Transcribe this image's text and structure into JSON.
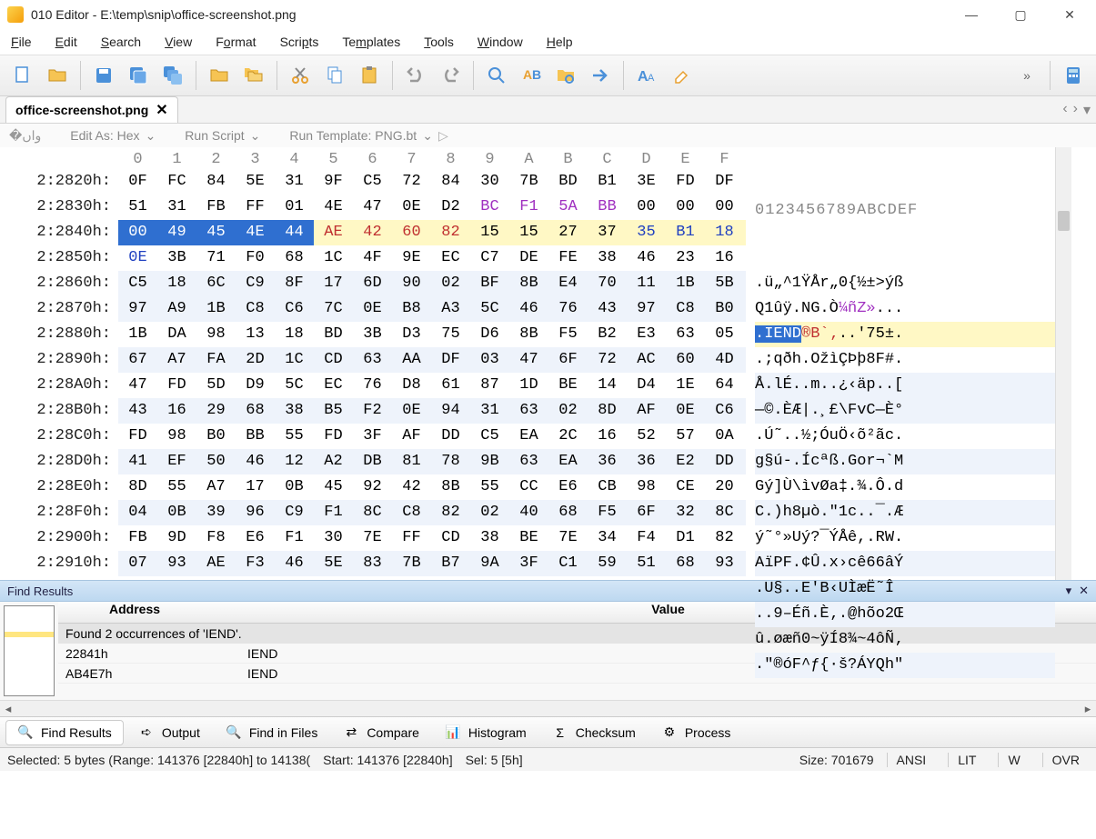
{
  "window": {
    "title": "010 Editor - E:\\temp\\snip\\office-screenshot.png"
  },
  "menu": [
    "File",
    "Edit",
    "Search",
    "View",
    "Format",
    "Scripts",
    "Templates",
    "Tools",
    "Window",
    "Help"
  ],
  "tab": {
    "label": "office-screenshot.png"
  },
  "subbar": {
    "editas": "Edit As: Hex",
    "runscript": "Run Script",
    "runtemplate": "Run Template: PNG.bt"
  },
  "hex": {
    "col_hdr": [
      "0",
      "1",
      "2",
      "3",
      "4",
      "5",
      "6",
      "7",
      "8",
      "9",
      "A",
      "B",
      "C",
      "D",
      "E",
      "F"
    ],
    "asc_hdr": "0123456789ABCDEF",
    "rows": [
      {
        "addr": "2:2820h:",
        "bytes": [
          "0F",
          "FC",
          "84",
          "5E",
          "31",
          "9F",
          "C5",
          "72",
          "84",
          "30",
          "7B",
          "BD",
          "B1",
          "3E",
          "FD",
          "DF"
        ],
        "asc": ".ü„^1ŸÅr„0{½±>ýß",
        "alt": false
      },
      {
        "addr": "2:2830h:",
        "bytes": [
          "51",
          "31",
          "FB",
          "FF",
          "01",
          "4E",
          "47",
          "0E",
          "D2",
          "BC",
          "F1",
          "5A",
          "BB",
          "00",
          "00",
          "00"
        ],
        "asc": "Q1ûÿ.NG.Ò¼ñZ»...",
        "alt": false,
        "purple": [
          9,
          10,
          11,
          12
        ]
      },
      {
        "addr": "2:2840h:",
        "bytes": [
          "00",
          "49",
          "45",
          "4E",
          "44",
          "AE",
          "42",
          "60",
          "82",
          "15",
          "15",
          "27",
          "37",
          "35",
          "B1",
          "18"
        ],
        "asc": ".IEND®B`‚..'75±.",
        "sel": [
          0,
          1,
          2,
          3,
          4
        ],
        "red": [
          5,
          6,
          7,
          8
        ],
        "blue": [
          13,
          14,
          15
        ],
        "hl": true
      },
      {
        "addr": "2:2850h:",
        "bytes": [
          "0E",
          "3B",
          "71",
          "F0",
          "68",
          "1C",
          "4F",
          "9E",
          "EC",
          "C7",
          "DE",
          "FE",
          "38",
          "46",
          "23",
          "16"
        ],
        "asc": ".;qðh.OžìÇÞþ8F#.",
        "blue": [
          0
        ],
        "alt": false
      },
      {
        "addr": "2:2860h:",
        "bytes": [
          "C5",
          "18",
          "6C",
          "C9",
          "8F",
          "17",
          "6D",
          "90",
          "02",
          "BF",
          "8B",
          "E4",
          "70",
          "11",
          "1B",
          "5B"
        ],
        "asc": "Å.lÉ..m..¿‹äp..[",
        "alt": true
      },
      {
        "addr": "2:2870h:",
        "bytes": [
          "97",
          "A9",
          "1B",
          "C8",
          "C6",
          "7C",
          "0E",
          "B8",
          "A3",
          "5C",
          "46",
          "76",
          "43",
          "97",
          "C8",
          "B0"
        ],
        "asc": "—©.ÈÆ|.¸£\\FvC—È°",
        "alt": true
      },
      {
        "addr": "2:2880h:",
        "bytes": [
          "1B",
          "DA",
          "98",
          "13",
          "18",
          "BD",
          "3B",
          "D3",
          "75",
          "D6",
          "8B",
          "F5",
          "B2",
          "E3",
          "63",
          "05"
        ],
        "asc": ".Ú˜..½;ÓuÖ‹õ²ãc.",
        "alt": false
      },
      {
        "addr": "2:2890h:",
        "bytes": [
          "67",
          "A7",
          "FA",
          "2D",
          "1C",
          "CD",
          "63",
          "AA",
          "DF",
          "03",
          "47",
          "6F",
          "72",
          "AC",
          "60",
          "4D"
        ],
        "asc": "g§ú-.Ícªß.Gor¬`M",
        "alt": true
      },
      {
        "addr": "2:28A0h:",
        "bytes": [
          "47",
          "FD",
          "5D",
          "D9",
          "5C",
          "EC",
          "76",
          "D8",
          "61",
          "87",
          "1D",
          "BE",
          "14",
          "D4",
          "1E",
          "64"
        ],
        "asc": "Gý]Ù\\ìvØa‡.¾.Ô.d",
        "alt": false
      },
      {
        "addr": "2:28B0h:",
        "bytes": [
          "43",
          "16",
          "29",
          "68",
          "38",
          "B5",
          "F2",
          "0E",
          "94",
          "31",
          "63",
          "02",
          "8D",
          "AF",
          "0E",
          "C6"
        ],
        "asc": "C.)h8µò.\"1c..¯.Æ",
        "alt": true
      },
      {
        "addr": "2:28C0h:",
        "bytes": [
          "FD",
          "98",
          "B0",
          "BB",
          "55",
          "FD",
          "3F",
          "AF",
          "DD",
          "C5",
          "EA",
          "2C",
          "16",
          "52",
          "57",
          "0A"
        ],
        "asc": "ý˜°»Uý?¯ÝÅê,.RW.",
        "alt": false
      },
      {
        "addr": "2:28D0h:",
        "bytes": [
          "41",
          "EF",
          "50",
          "46",
          "12",
          "A2",
          "DB",
          "81",
          "78",
          "9B",
          "63",
          "EA",
          "36",
          "36",
          "E2",
          "DD"
        ],
        "asc": "AïPF.¢Û.x›cê66âÝ",
        "alt": true
      },
      {
        "addr": "2:28E0h:",
        "bytes": [
          "8D",
          "55",
          "A7",
          "17",
          "0B",
          "45",
          "92",
          "42",
          "8B",
          "55",
          "CC",
          "E6",
          "CB",
          "98",
          "CE",
          "20"
        ],
        "asc": ".U§..E'B‹UÌæË˜Î ",
        "alt": false
      },
      {
        "addr": "2:28F0h:",
        "bytes": [
          "04",
          "0B",
          "39",
          "96",
          "C9",
          "F1",
          "8C",
          "C8",
          "82",
          "02",
          "40",
          "68",
          "F5",
          "6F",
          "32",
          "8C"
        ],
        "asc": "..9–Éñ.È‚.@hõo2Œ",
        "alt": true
      },
      {
        "addr": "2:2900h:",
        "bytes": [
          "FB",
          "9D",
          "F8",
          "E6",
          "F1",
          "30",
          "7E",
          "FF",
          "CD",
          "38",
          "BE",
          "7E",
          "34",
          "F4",
          "D1",
          "82"
        ],
        "asc": "û.øæñ0~ÿÍ8¾~4ôÑ‚",
        "alt": false
      },
      {
        "addr": "2:2910h:",
        "bytes": [
          "07",
          "93",
          "AE",
          "F3",
          "46",
          "5E",
          "83",
          "7B",
          "B7",
          "9A",
          "3F",
          "C1",
          "59",
          "51",
          "68",
          "93"
        ],
        "asc": ".\"®óF^ƒ{·š?ÁYQh\"",
        "alt": true
      }
    ]
  },
  "find": {
    "title": "Find Results",
    "col_addr": "Address",
    "col_val": "Value",
    "msg": "Found 2 occurrences of 'IEND'.",
    "rows": [
      {
        "addr": "22841h",
        "val": "IEND"
      },
      {
        "addr": "AB4E7h",
        "val": "IEND"
      }
    ]
  },
  "bottom_tabs": [
    {
      "label": "Find Results",
      "icon": "search"
    },
    {
      "label": "Output",
      "icon": "arrow"
    },
    {
      "label": "Find in Files",
      "icon": "search"
    },
    {
      "label": "Compare",
      "icon": "compare"
    },
    {
      "label": "Histogram",
      "icon": "histogram"
    },
    {
      "label": "Checksum",
      "icon": "checksum"
    },
    {
      "label": "Process",
      "icon": "process"
    }
  ],
  "status": {
    "selected": "Selected: 5 bytes (Range: 141376 [22840h] to 14138(",
    "start": "Start: 141376 [22840h]",
    "sel": "Sel: 5 [5h]",
    "size": "Size: 701679",
    "ansi": "ANSI",
    "lit": "LIT",
    "w": "W",
    "ovr": "OVR"
  }
}
